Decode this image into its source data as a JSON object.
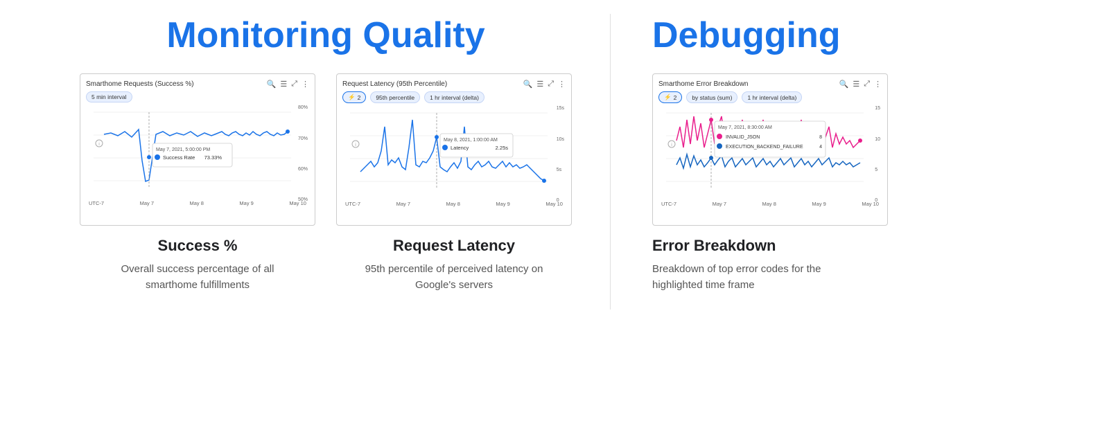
{
  "left_title": "Monitoring Quality",
  "right_title": "Debugging",
  "cards": [
    {
      "id": "success",
      "chart_title": "Smarthome Requests (Success %)",
      "filter_badges": [
        "5 min interval"
      ],
      "y_labels": [
        "80%",
        "70%",
        "60%",
        "50%"
      ],
      "x_labels": [
        "UTC-7",
        "May 7",
        "May 8",
        "May 9",
        "May 10"
      ],
      "tooltip_date": "May 7, 2021, 5:00:00 PM",
      "tooltip_series": "Success Rate",
      "tooltip_value": "73.33%",
      "tooltip_color": "#1a73e8",
      "label": "Success %",
      "desc": "Overall success percentage of all smarthome fulfillments"
    },
    {
      "id": "latency",
      "chart_title": "Request Latency (95th Percentile)",
      "filter_badges": [
        "2",
        "95th percentile",
        "1 hr interval (delta)"
      ],
      "y_labels": [
        "15s",
        "10s",
        "5s",
        "0"
      ],
      "x_labels": [
        "UTC-7",
        "May 7",
        "May 8",
        "May 9",
        "May 10"
      ],
      "tooltip_date": "May 8, 2021, 1:00:00 AM",
      "tooltip_series": "Latency",
      "tooltip_value": "2.25s",
      "tooltip_color": "#1a73e8",
      "label": "Request Latency",
      "desc": "95th percentile of perceived latency on Google's servers"
    }
  ],
  "right_card": {
    "chart_title": "Smarthome Error Breakdown",
    "filter_badges": [
      "2",
      "by status (sum)",
      "1 hr interval (delta)"
    ],
    "y_labels": [
      "15",
      "10",
      "5",
      "0"
    ],
    "x_labels": [
      "UTC-7",
      "May 7",
      "May 8",
      "May 9",
      "May 10"
    ],
    "tooltip_date": "May 7, 2021, 8:30:00 AM",
    "tooltip_rows": [
      {
        "series": "INVALID_JSON",
        "value": "8",
        "color": "#e91e8c"
      },
      {
        "series": "EXECUTION_BACKEND_FAILURE",
        "value": "4",
        "color": "#1565c0"
      }
    ],
    "label": "Error Breakdown",
    "desc": "Breakdown of top error codes for the highlighted time frame"
  },
  "icons": {
    "search": "🔍",
    "legend": "≡",
    "expand": "⤢",
    "more": "⋮"
  }
}
